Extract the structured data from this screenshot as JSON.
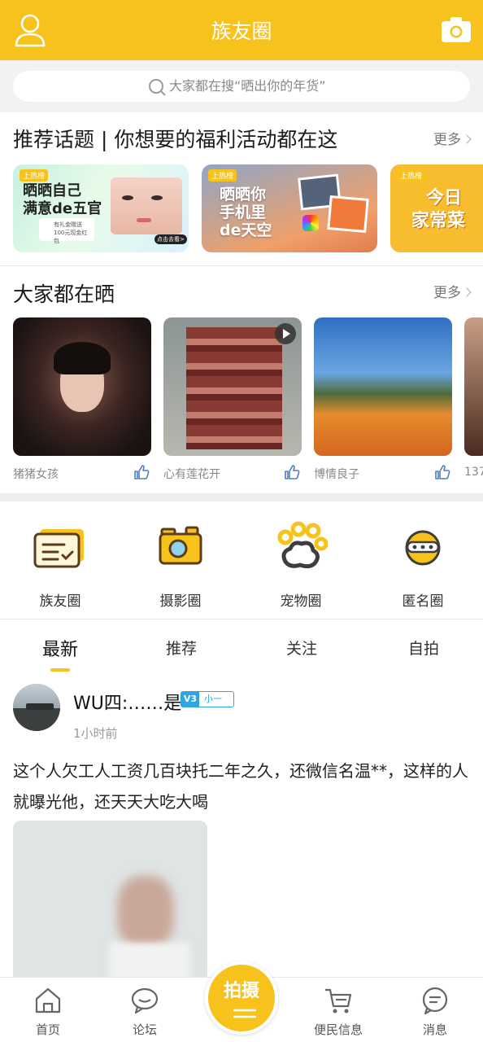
{
  "header": {
    "title": "族友圈",
    "user_icon": "user-icon",
    "camera_icon": "camera-icon"
  },
  "search": {
    "placeholder": "大家都在搜“晒出你的年货”"
  },
  "topics": {
    "title": "推荐话题 | 你想要的福利活动都在这",
    "more": "更多",
    "cards": [
      {
        "tag": "上热榜",
        "line1": "晒晒自己",
        "line2": "满意de五官",
        "sub": "有礼金赠送",
        "sub2": "100元现金红包",
        "cta": "点击去看>"
      },
      {
        "tag": "上热榜",
        "line1": "晒晒你",
        "line2": "手机里",
        "line3": "de天空"
      },
      {
        "tag": "上热榜",
        "line1": "今日",
        "line2": "家常菜"
      }
    ]
  },
  "sharing": {
    "title": "大家都在晒",
    "more": "更多",
    "items": [
      {
        "name": "猪猪女孩"
      },
      {
        "name": "心有莲花开"
      },
      {
        "name": "博情良子"
      },
      {
        "name": "137"
      }
    ]
  },
  "circles": [
    {
      "label": "族友圈",
      "icon": "chat-list-icon"
    },
    {
      "label": "摄影圈",
      "icon": "camera-icon"
    },
    {
      "label": "宠物圈",
      "icon": "paw-icon"
    },
    {
      "label": "匿名圈",
      "icon": "anonymous-icon"
    }
  ],
  "tabs": [
    "最新",
    "推荐",
    "关注",
    "自拍"
  ],
  "active_tab": "最新",
  "post": {
    "username": "WU四:……是",
    "badge_v": "V3",
    "badge_level": "小一",
    "time": "1小时前",
    "text": "这个人欠工人工资几百块托二年之久，还微信名温**，这样的人就曝光他，还天天大吃大喝"
  },
  "bottom_nav": {
    "items": [
      {
        "label": "首页",
        "icon": "home-icon"
      },
      {
        "label": "论坛",
        "icon": "forum-icon"
      },
      {
        "label": "便民信息",
        "icon": "cart-icon"
      },
      {
        "label": "消息",
        "icon": "message-icon"
      }
    ],
    "shoot_label": "拍摄"
  },
  "colors": {
    "accent": "#f8c21c",
    "badge": "#2ea7e0"
  }
}
